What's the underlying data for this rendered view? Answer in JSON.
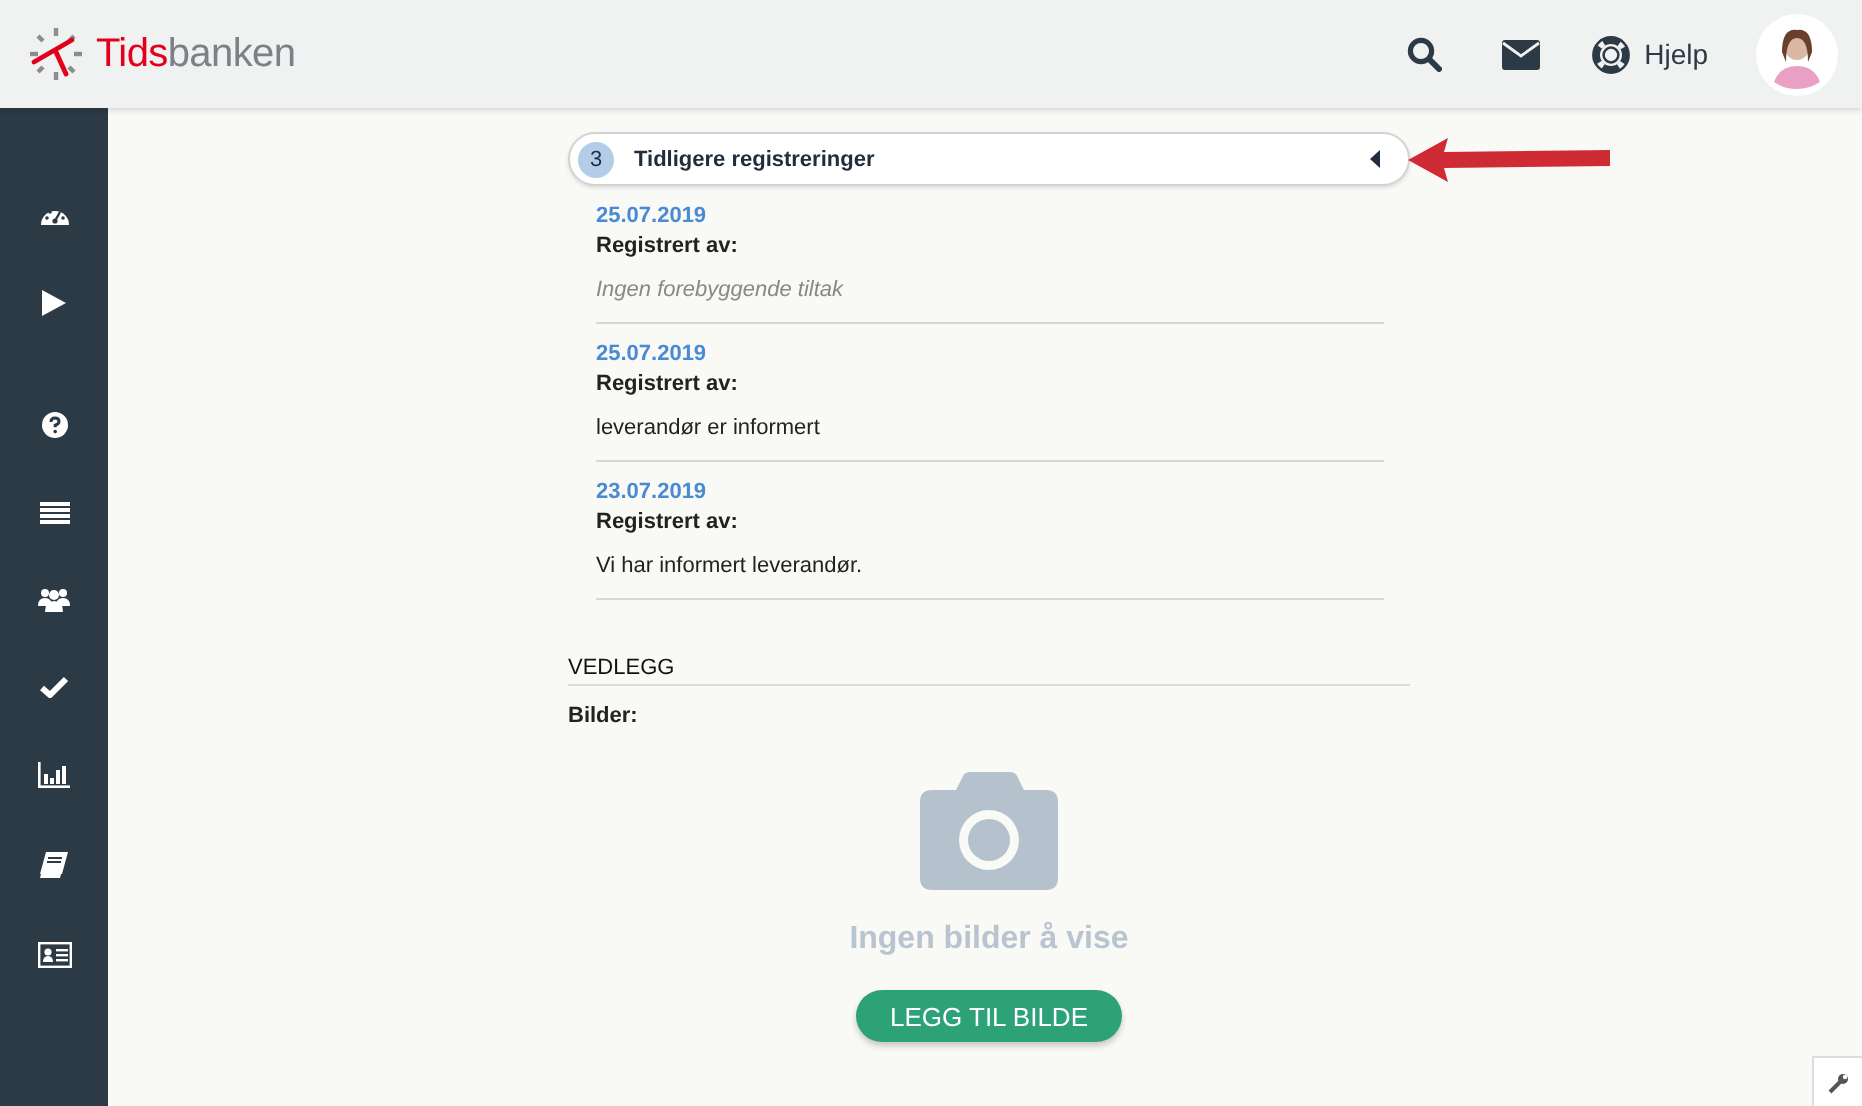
{
  "header": {
    "brand": {
      "accent": "Tids",
      "rest": "banken"
    },
    "help_label": "Hjelp"
  },
  "history": {
    "count": "3",
    "title": "Tidligere registreringer",
    "expanded": true,
    "entries": [
      {
        "date": "25.07.2019",
        "label": "Registrert av:",
        "note": "Ingen forebyggende tiltak",
        "kind": "empty"
      },
      {
        "date": "25.07.2019",
        "label": "Registrert av:",
        "note": "leverandør er informert",
        "kind": "text"
      },
      {
        "date": "23.07.2019",
        "label": "Registrert av:",
        "note": "Vi har informert leverandør.",
        "kind": "text"
      }
    ]
  },
  "attachments": {
    "heading": "VEDLEGG",
    "images_label": "Bilder:",
    "empty_message": "Ingen bilder å vise",
    "add_button": "LEGG TIL BILDE"
  }
}
